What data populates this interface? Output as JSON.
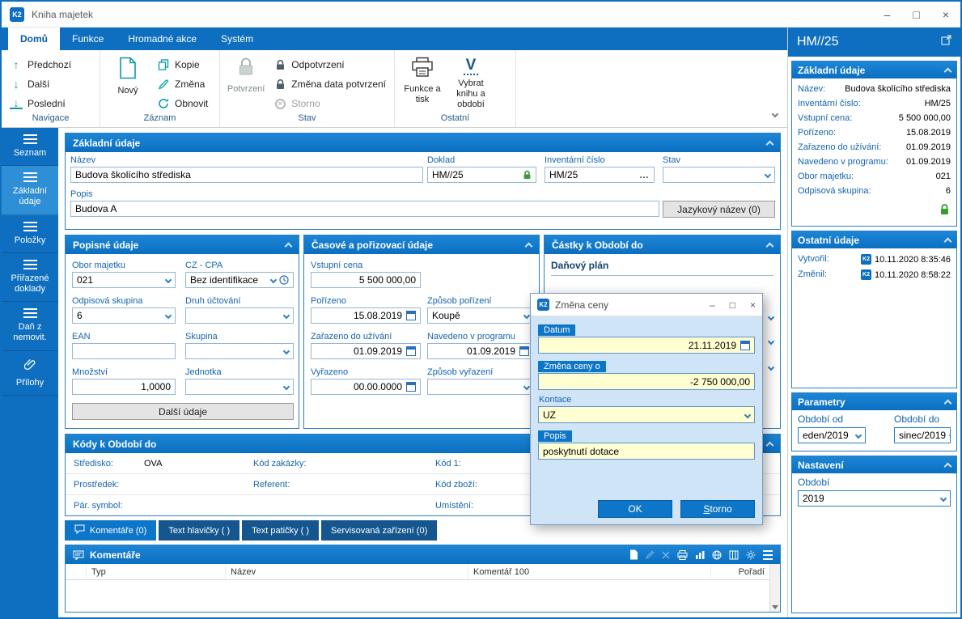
{
  "colors": {
    "accent_blue": "#0e6fc0",
    "panel_header_blue": "#0e76c8",
    "field_yellow": "#ffffd2",
    "lock_green": "#33a02c"
  },
  "titlebar": {
    "logo": "K2",
    "app_title": "Kniha majetek",
    "controls": {
      "minimize": "–",
      "maximize": "□",
      "close": "×"
    }
  },
  "ribbon": {
    "tabs": [
      {
        "label": "Domů"
      },
      {
        "label": "Funkce"
      },
      {
        "label": "Hromadné akce"
      },
      {
        "label": "Systém"
      }
    ],
    "nav": {
      "group_label": "Navigace",
      "prev": "Předchozí",
      "next": "Další",
      "last": "Poslední"
    },
    "record": {
      "group_label": "Záznam",
      "new": "Nový",
      "copy": "Kopie",
      "change": "Změna",
      "refresh": "Obnovit"
    },
    "state": {
      "group_label": "Stav",
      "confirm": "Potvrzení",
      "unconfirm": "Odpotvrzení",
      "change_date": "Změna data potvrzení",
      "cancel": "Storno"
    },
    "other": {
      "group_label": "Ostatní",
      "print": "Funkce a tisk",
      "select_book": "Vybrat knihu a období",
      "select_icon": "V"
    }
  },
  "sidebar": {
    "items": [
      {
        "label": "Seznam"
      },
      {
        "label": "Základní údaje"
      },
      {
        "label": "Položky"
      },
      {
        "label": "Přiřazené doklady"
      },
      {
        "label": "Daň z nemovit."
      },
      {
        "label": "Přílohy"
      }
    ]
  },
  "basic_panel": {
    "title": "Základní údaje",
    "nazev_label": "Název",
    "nazev_value": "Budova školícího střediska",
    "doklad_label": "Doklad",
    "doklad_value": "HM//25",
    "inv_label": "Inventární číslo",
    "inv_value": "HM/25",
    "inv_more": "…",
    "stav_label": "Stav",
    "popis_label": "Popis",
    "popis_value": "Budova A",
    "jazykovy_button": "Jazykový název (0)"
  },
  "descriptive_panel": {
    "title": "Popisné údaje",
    "obor_label": "Obor majetku",
    "obor_value": "021",
    "czcpa_label": "CZ - CPA",
    "czcpa_value": "Bez identifikace",
    "odpisova_label": "Odpisová skupina",
    "odpisova_value": "6",
    "druh_label": "Druh účtování",
    "ean_label": "EAN",
    "skupina_label": "Skupina",
    "mnozstvi_label": "Množství",
    "mnozstvi_value": "1,0000",
    "jednotka_label": "Jednotka",
    "dalsi_button": "Další údaje"
  },
  "time_panel": {
    "title": "Časové a pořizovací údaje",
    "vstupni_label": "Vstupní cena",
    "vstupni_value": "5 500 000,00",
    "porizeno_label": "Pořízeno",
    "porizeno_value": "15.08.2019",
    "zpusob_por_label": "Způsob pořízení",
    "zpusob_por_value": "Koupě",
    "zarazeno_label": "Zařazeno do užívání",
    "zarazeno_value": "01.09.2019",
    "navedeno_label": "Navedeno v programu",
    "navedeno_value": "01.09.2019",
    "vyrazeno_label": "Vyřazeno",
    "vyrazeno_value": "00.00.0000",
    "zpusob_vyr_label": "Způsob vyřazení"
  },
  "amounts_panel": {
    "title": "Částky k Období do",
    "tax_plan": "Daňový plán"
  },
  "codes_panel": {
    "title": "Kódy k Období do",
    "stredisko_label": "Středisko:",
    "stredisko_value": "OVA",
    "kod_zakazky_label": "Kód zakázky:",
    "kod1_label": "Kód 1:",
    "prostredek_label": "Prostředek:",
    "referent_label": "Referent:",
    "kod_zbozi_label": "Kód zboží:",
    "par_symbol_label": "Pár. symbol:",
    "umisteni_label": "Umístění:"
  },
  "bottom_tabs": {
    "komentare": "Komentáře (0)",
    "text_hlavicky": "Text hlavičky ( )",
    "text_paticky": "Text patičky ( )",
    "servisovana": "Servisovaná zařízení (0)"
  },
  "comments_panel": {
    "title": "Komentáře",
    "columns": {
      "typ": "Typ",
      "nazev": "Název",
      "komentar": "Komentář 100",
      "poradi": "Pořadí"
    }
  },
  "dialog": {
    "title": "Změna ceny",
    "datum_label": "Datum",
    "datum_value": "21.11.2019",
    "zmena_label": "Změna ceny o",
    "zmena_value": "-2 750 000,00",
    "kontace_label": "Kontace",
    "kontace_value": "UZ",
    "popis_label": "Popis",
    "popis_value": "poskytnutí dotace",
    "ok_button": "OK",
    "storno_button_accesskey": "S",
    "storno_button_rest": "torno"
  },
  "right_panel": {
    "header": "HM//25",
    "zakladni": {
      "title": "Základní údaje",
      "rows": [
        {
          "label": "Název:",
          "value": "Budova školícího střediska"
        },
        {
          "label": "Inventární číslo:",
          "value": "HM/25"
        },
        {
          "label": "Vstupní cena:",
          "value": "5 500 000,00"
        },
        {
          "label": "Pořízeno:",
          "value": "15.08.2019"
        },
        {
          "label": "Zařazeno do užívání:",
          "value": "01.09.2019"
        },
        {
          "label": "Navedeno v programu:",
          "value": "01.09.2019"
        },
        {
          "label": "Obor majetku:",
          "value": "021"
        },
        {
          "label": "Odpisová skupina:",
          "value": "6"
        }
      ]
    },
    "ostatni": {
      "title": "Ostatní údaje",
      "badge": "K2",
      "rows": [
        {
          "label": "Vytvořil:",
          "value": "10.11.2020 8:35:46"
        },
        {
          "label": "Změnil:",
          "value": "10.11.2020 8:58:22"
        }
      ]
    },
    "parametry": {
      "title": "Parametry",
      "od_label": "Období od",
      "od_value": "eden/2019",
      "do_label": "Období do",
      "do_value": "sinec/2019"
    },
    "nastaveni": {
      "title": "Nastavení",
      "obdobi_label": "Období",
      "obdobi_value": "2019"
    }
  }
}
